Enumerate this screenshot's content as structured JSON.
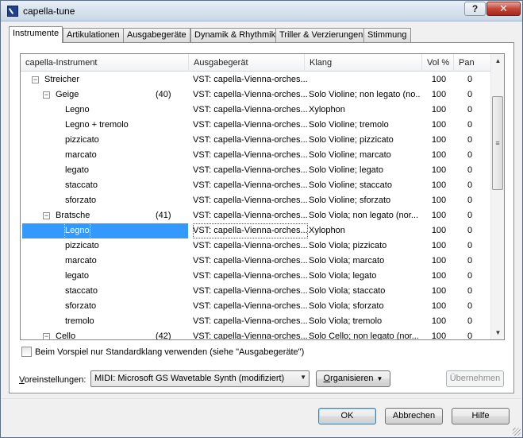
{
  "window": {
    "title": "capella-tune",
    "icon": "capella-app-icon",
    "help_label": "?",
    "close_label": "✕"
  },
  "tabs": [
    {
      "label": "Instrumente",
      "active": true
    },
    {
      "label": "Artikulationen"
    },
    {
      "label": "Ausgabegeräte"
    },
    {
      "label": "Dynamik & Rhythmik"
    },
    {
      "label": "Triller & Verzierungen"
    },
    {
      "label": "Stimmung"
    }
  ],
  "tree": {
    "headers": {
      "instrument": "capella-Instrument",
      "output": "Ausgabegerät",
      "sound": "Klang",
      "vol": "Vol %",
      "pan": "Pan"
    },
    "rows": [
      {
        "level": 0,
        "toggle": "−",
        "name": "Streicher",
        "count": "",
        "output": "VST: capella-Vienna-orches...",
        "sound": "",
        "vol": "100",
        "pan": "0"
      },
      {
        "level": 1,
        "toggle": "−",
        "name": "Geige",
        "count": "(40)",
        "output": "VST: capella-Vienna-orches...",
        "sound": "Solo Violine; non legato (no...",
        "vol": "100",
        "pan": "0"
      },
      {
        "level": 2,
        "name": "Legno",
        "count": "",
        "output": "VST: capella-Vienna-orches...",
        "sound": "Xylophon",
        "vol": "100",
        "pan": "0"
      },
      {
        "level": 2,
        "name": "Legno + tremolo",
        "count": "",
        "output": "VST: capella-Vienna-orches...",
        "sound": "Solo Violine; tremolo",
        "vol": "100",
        "pan": "0"
      },
      {
        "level": 2,
        "name": "pizzicato",
        "count": "",
        "output": "VST: capella-Vienna-orches...",
        "sound": "Solo Violine; pizzicato",
        "vol": "100",
        "pan": "0"
      },
      {
        "level": 2,
        "name": "marcato",
        "count": "",
        "output": "VST: capella-Vienna-orches...",
        "sound": "Solo Violine; marcato",
        "vol": "100",
        "pan": "0"
      },
      {
        "level": 2,
        "name": "legato",
        "count": "",
        "output": "VST: capella-Vienna-orches...",
        "sound": "Solo Violine; legato",
        "vol": "100",
        "pan": "0"
      },
      {
        "level": 2,
        "name": "staccato",
        "count": "",
        "output": "VST: capella-Vienna-orches...",
        "sound": "Solo Violine; staccato",
        "vol": "100",
        "pan": "0"
      },
      {
        "level": 2,
        "name": "sforzato",
        "count": "",
        "output": "VST: capella-Vienna-orches...",
        "sound": "Solo Violine; sforzato",
        "vol": "100",
        "pan": "0"
      },
      {
        "level": 1,
        "toggle": "−",
        "name": "Bratsche",
        "count": "(41)",
        "output": "VST: capella-Vienna-orches...",
        "sound": "Solo Viola; non legato (nor...",
        "vol": "100",
        "pan": "0"
      },
      {
        "level": 2,
        "name": "Legno",
        "count": "",
        "output": "VST: capella-Vienna-orches...",
        "sound": "Xylophon",
        "vol": "100",
        "pan": "0",
        "selected": true
      },
      {
        "level": 2,
        "name": "pizzicato",
        "count": "",
        "output": "VST: capella-Vienna-orches...",
        "sound": "Solo Viola; pizzicato",
        "vol": "100",
        "pan": "0"
      },
      {
        "level": 2,
        "name": "marcato",
        "count": "",
        "output": "VST: capella-Vienna-orches...",
        "sound": "Solo Viola; marcato",
        "vol": "100",
        "pan": "0"
      },
      {
        "level": 2,
        "name": "legato",
        "count": "",
        "output": "VST: capella-Vienna-orches...",
        "sound": "Solo Viola; legato",
        "vol": "100",
        "pan": "0"
      },
      {
        "level": 2,
        "name": "staccato",
        "count": "",
        "output": "VST: capella-Vienna-orches...",
        "sound": "Solo Viola; staccato",
        "vol": "100",
        "pan": "0"
      },
      {
        "level": 2,
        "name": "sforzato",
        "count": "",
        "output": "VST: capella-Vienna-orches...",
        "sound": "Solo Viola; sforzato",
        "vol": "100",
        "pan": "0"
      },
      {
        "level": 2,
        "name": "tremolo",
        "count": "",
        "output": "VST: capella-Vienna-orches...",
        "sound": "Solo Viola; tremolo",
        "vol": "100",
        "pan": "0"
      },
      {
        "level": 1,
        "toggle": "−",
        "name": "Cello",
        "count": "(42)",
        "output": "VST: capella-Vienna-orches...",
        "sound": "Solo Cello; non legato (nor...",
        "vol": "100",
        "pan": "0"
      }
    ],
    "scrollbar": {
      "up": "▲",
      "down": "▼",
      "thumb": "≡"
    }
  },
  "options": {
    "checkbox_label": "Beim Vorspiel nur Standardklang verwenden (siehe \"Ausgabegeräte\")",
    "checked": false
  },
  "presets": {
    "label_prefix": "V",
    "label_rest": "oreinstellungen:",
    "value": "MIDI: Microsoft GS Wavetable Synth (modifiziert)",
    "organize_prefix": "O",
    "organize_rest": "rganisieren",
    "apply_label": "Übernehmen"
  },
  "footer": {
    "ok_label": "OK",
    "cancel_label": "Abbrechen",
    "help_label": "Hilfe"
  }
}
